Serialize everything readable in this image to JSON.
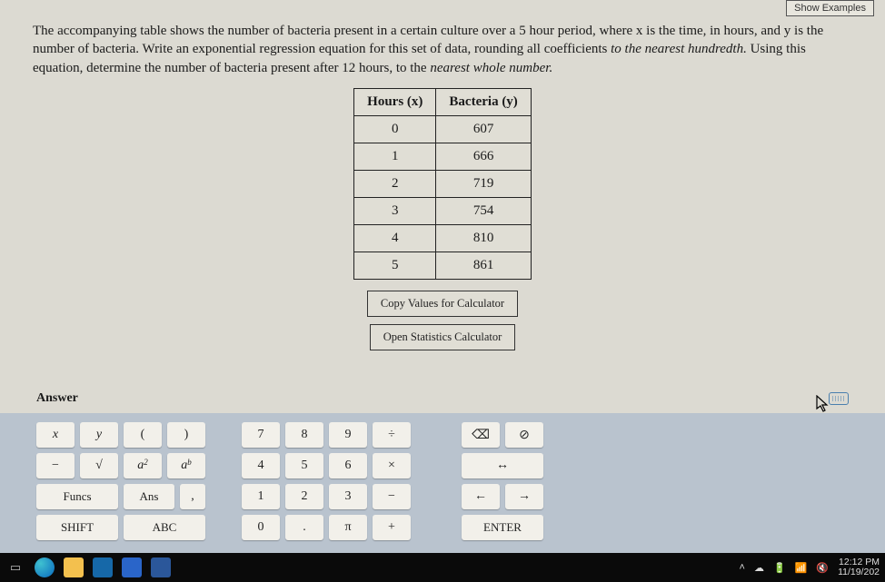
{
  "header": {
    "show_examples": "Show Examples"
  },
  "prompt": {
    "s1": "The accompanying table shows the number of bacteria present in a certain culture over a 5 hour period, where x is the time, in hours, and y is the number of bacteria. Write an exponential regression equation for this set of data, rounding all coefficients ",
    "em1": "to the nearest hundredth.",
    "s2": " Using this equation, determine the number of bacteria present after 12 hours, to the ",
    "em2": "nearest whole number.",
    "s3": ""
  },
  "chart_data": {
    "type": "table",
    "columns": [
      "Hours (x)",
      "Bacteria (y)"
    ],
    "rows": [
      {
        "x": "0",
        "y": "607"
      },
      {
        "x": "1",
        "y": "666"
      },
      {
        "x": "2",
        "y": "719"
      },
      {
        "x": "3",
        "y": "754"
      },
      {
        "x": "4",
        "y": "810"
      },
      {
        "x": "5",
        "y": "861"
      }
    ]
  },
  "buttons": {
    "copy": "Copy Values for Calculator",
    "open": "Open Statistics Calculator"
  },
  "answer": {
    "label": "Answer"
  },
  "keys": {
    "x": "x",
    "y": "y",
    "lp": "(",
    "rp": ")",
    "n7": "7",
    "n8": "8",
    "n9": "9",
    "div": "÷",
    "back": "⌫",
    "ban": "⊘",
    "minus": "−",
    "sqrt": "√",
    "a2": "a",
    "a2sup": "2",
    "ab": "a",
    "absup": "b",
    "n4": "4",
    "n5": "5",
    "n6": "6",
    "mul": "×",
    "lr": "↔",
    "funcs": "Funcs",
    "ans": "Ans",
    "comma": ",",
    "n1": "1",
    "n2": "2",
    "n3": "3",
    "sub": "−",
    "left": "←",
    "right": "→",
    "shift": "SHIFT",
    "abc": "ABC",
    "n0": "0",
    "dot": ".",
    "pi": "π",
    "plus": "+",
    "enter": "ENTER"
  },
  "taskbar": {
    "time": "12:12 PM",
    "date": "11/19/202"
  }
}
